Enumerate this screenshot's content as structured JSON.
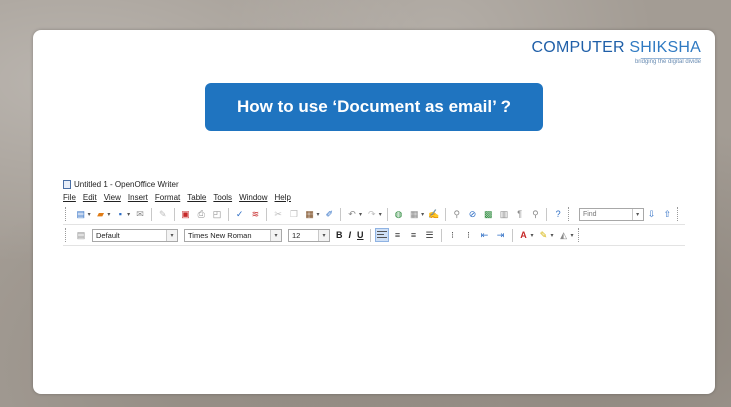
{
  "logo": {
    "part1": "COMPUTER",
    "part2": " SHIKSHA",
    "tagline": "bridging the digital divide"
  },
  "title": "How to use ‘Document as email’ ?",
  "writer": {
    "window_title": "Untitled 1 - OpenOffice Writer",
    "menu": [
      "File",
      "Edit",
      "View",
      "Insert",
      "Format",
      "Table",
      "Tools",
      "Window",
      "Help"
    ],
    "find": {
      "placeholder": "Find"
    },
    "formatting": {
      "style": "Default",
      "font": "Times New Roman",
      "size": "12",
      "bold": "B",
      "italic": "I",
      "underline": "U"
    }
  },
  "colors": {
    "accent": "#1f74c0",
    "logo": "#2a6db5"
  }
}
